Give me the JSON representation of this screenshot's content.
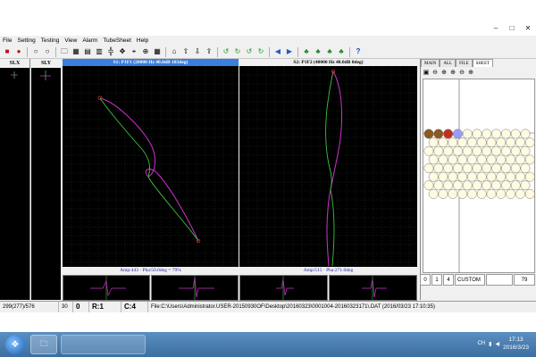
{
  "menu": [
    "File",
    "Setting",
    "Testing",
    "View",
    "Alarm",
    "TubeSheet",
    "Help"
  ],
  "window_buttons": [
    "–",
    "□",
    "✕"
  ],
  "toolbar": {
    "icons": [
      "stop-icon",
      "record-icon",
      "ring-icon",
      "ring-icon",
      "open-folder-icon",
      "save-icon",
      "table-icon",
      "chart-icon",
      "balance-icon",
      "cross-icon",
      "cursor-icon",
      "zoom-icon",
      "grid-icon",
      "home-icon",
      "up-icon",
      "down-icon",
      "exit-icon",
      "rotate-left-icon",
      "rotate-right-icon",
      "rotate-icon",
      "rotate-back-icon",
      "prev-icon",
      "next-icon",
      "tube-icon",
      "tube-icon",
      "tube-icon",
      "tube-icon",
      "help-icon"
    ],
    "glyphs": [
      "■",
      "●",
      "○",
      "○",
      "🗀",
      "▦",
      "▤",
      "▥",
      "╬",
      "✥",
      "⌖",
      "⊕",
      "▦",
      "⌂",
      "⇧",
      "⇩",
      "⇪",
      "↺",
      "↻",
      "↺",
      "↻",
      "◀",
      "▶",
      "♣",
      "♣",
      "♣",
      "♣",
      "?"
    ]
  },
  "strip_panels": {
    "slx": "SLX",
    "sly": "SLY"
  },
  "plots": {
    "s1": {
      "title": "S1: P1F1 (20000 Hz 40.0dB 183deg)",
      "amp": "Amp:443 · Pha:50.0deg = 79%"
    },
    "s2": {
      "title": "S2: P1F2 (40000 Hz 40.0dB 0deg)",
      "amp": "Amp:515 · Pha:271.0deg"
    }
  },
  "right_panel": {
    "tabs": [
      "MAIN",
      "ALL",
      "FILE",
      "SHEET"
    ],
    "active_tab": "SHEET",
    "tools": [
      "▣",
      "⊖",
      "⊕",
      "⊕",
      "⊖",
      "⊕"
    ],
    "info": [
      "0",
      "1",
      "4",
      "CUSTOM",
      "",
      "79"
    ]
  },
  "status": {
    "position": "299(277)/576",
    "val30": "30",
    "val0": "0",
    "r": "R:1",
    "c": "C:4",
    "file": "File:C:\\Users\\Administrator.USER-20150930OF\\Desktop\\20160323\\0001004-20160323171\\.DAT  (2016/03/23  17:10:35)"
  },
  "taskbar": {
    "time": "17:13",
    "date": "2016/3/23",
    "tray": "CH"
  },
  "colors": {
    "magenta": "#d030d0",
    "green": "#40c040",
    "grid": "#1e3a1e"
  }
}
